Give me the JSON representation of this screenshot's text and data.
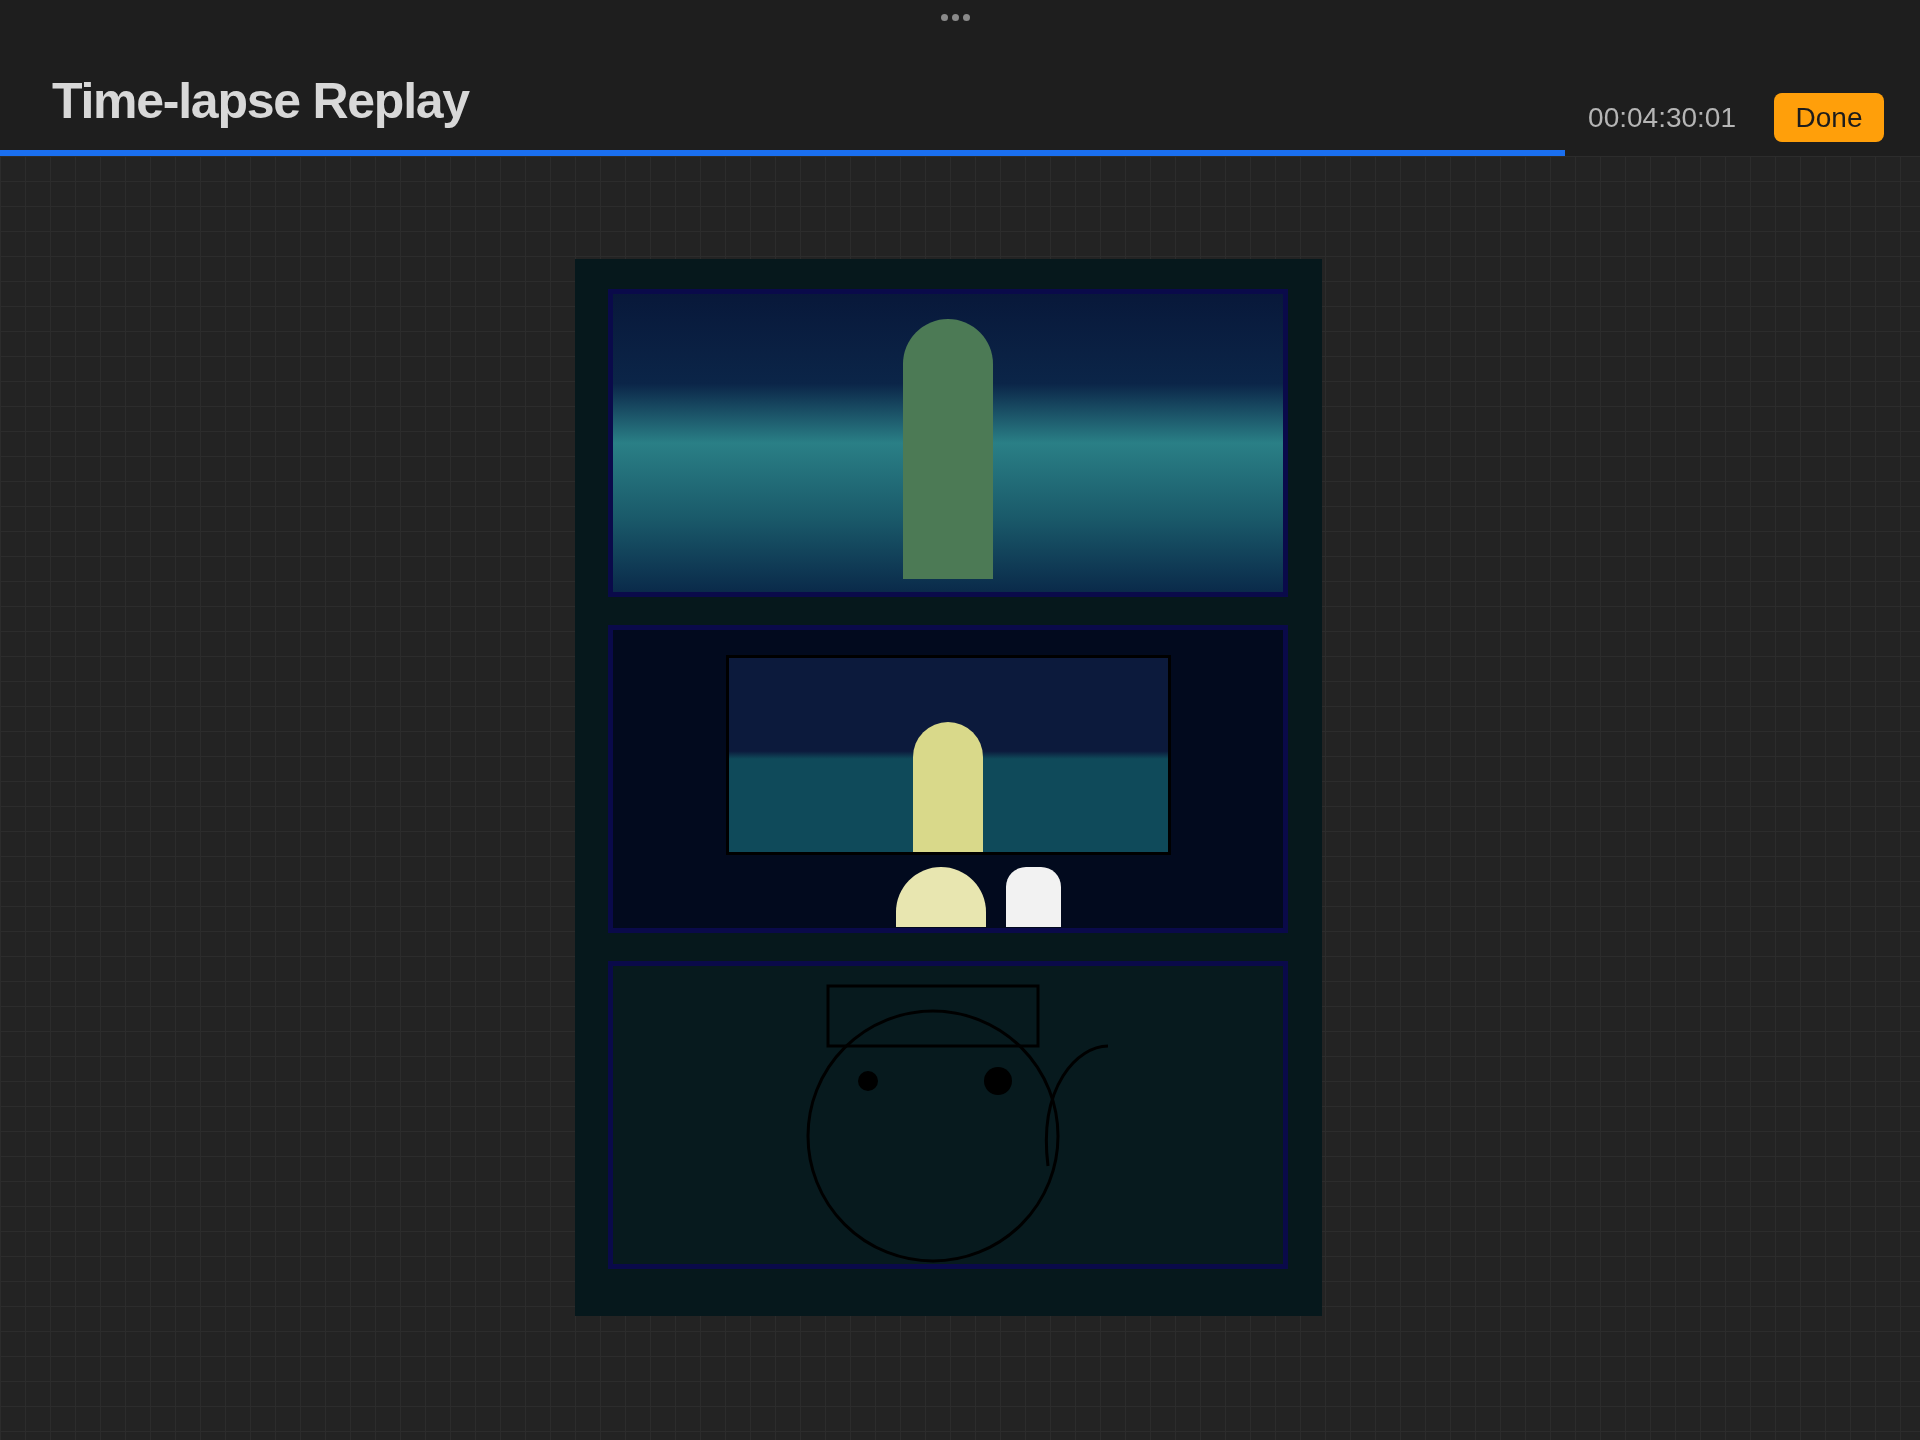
{
  "header": {
    "title": "Time-lapse Replay",
    "timecode": "00:04:30:01",
    "done_button": "Done"
  },
  "progress": {
    "level": 0.815
  }
}
